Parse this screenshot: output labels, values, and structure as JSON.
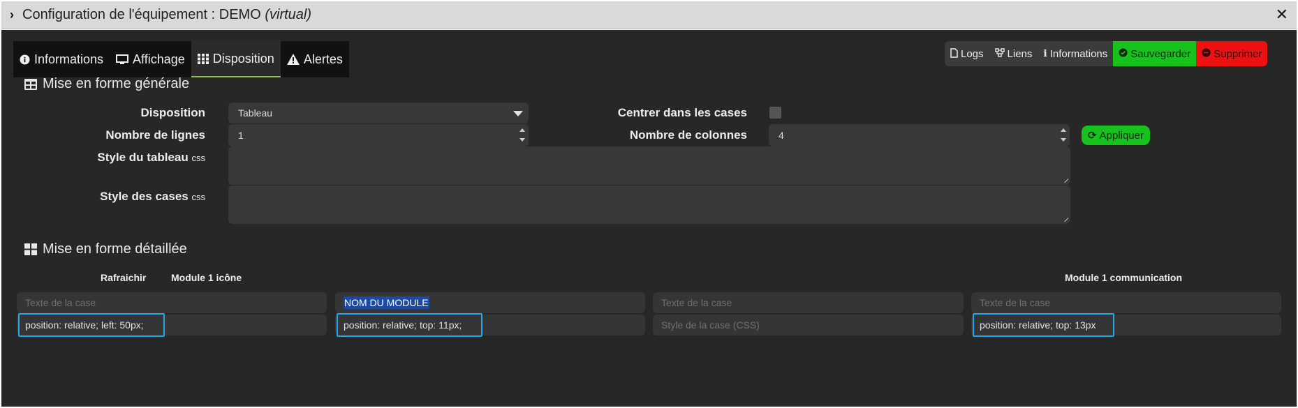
{
  "window": {
    "title_prefix": "Configuration de l'équipement : DEMO ",
    "title_suffix": "(virtual)",
    "close": "✕"
  },
  "tabs": [
    {
      "label": "Informations",
      "icon": "info-circle-icon",
      "active": false
    },
    {
      "label": "Affichage",
      "icon": "monitor-icon",
      "active": false
    },
    {
      "label": "Disposition",
      "icon": "grid-icon",
      "active": true
    },
    {
      "label": "Alertes",
      "icon": "warning-icon",
      "active": false
    }
  ],
  "actions": {
    "logs": "Logs",
    "links": "Liens",
    "informations": "Informations",
    "save": "Sauvegarder",
    "delete": "Supprimer"
  },
  "general": {
    "section_title": "Mise en forme générale",
    "disposition_label": "Disposition",
    "disposition_value": "Tableau",
    "center_label": "Centrer dans les cases",
    "rows_label": "Nombre de lignes",
    "rows_value": "1",
    "cols_label": "Nombre de colonnes",
    "cols_value": "4",
    "apply_label": "Appliquer",
    "table_style_label": "Style du tableau",
    "cell_style_label": "Style des cases",
    "css_suffix": "css"
  },
  "detailed": {
    "section_title": "Mise en forme détaillée",
    "col_labels": {
      "refresh": "Rafraichir",
      "module_icon": "Module 1 icône",
      "module_comm": "Module 1 communication"
    },
    "cells": [
      {
        "text_placeholder": "Texte de la case",
        "text_value": "",
        "style_placeholder": "Style de la case (CSS)",
        "style_value": "position: relative; left: 50px;"
      },
      {
        "text_placeholder": "Texte de la case",
        "text_value": "NOM DU MODULE",
        "style_placeholder": "Style de la case (CSS)",
        "style_value": "position: relative; top: 11px;"
      },
      {
        "text_placeholder": "Texte de la case",
        "text_value": "",
        "style_placeholder": "Style de la case (CSS)",
        "style_value": ""
      },
      {
        "text_placeholder": "Texte de la case",
        "text_value": "",
        "style_placeholder": "Style de la case (CSS)",
        "style_value": "position: relative; top: 13px"
      }
    ]
  },
  "colors": {
    "accent_green": "#18c21d",
    "danger_red": "#ee1111",
    "highlight_blue": "#22a7e8",
    "background": "#272727"
  }
}
